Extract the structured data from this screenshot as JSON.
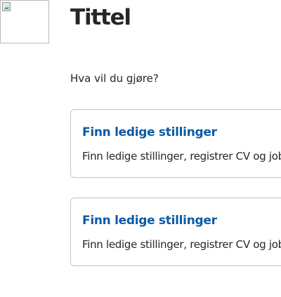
{
  "header": {
    "title": "Tittel"
  },
  "intro": {
    "question": "Hva vil du gjøre?"
  },
  "cards": [
    {
      "title": "Finn ledige stillinger",
      "description": "Finn ledige stillinger, registrer CV og jobbprofil"
    },
    {
      "title": "Finn ledige stillinger",
      "description": "Finn ledige stillinger, registrer CV og jobbprofil"
    }
  ]
}
